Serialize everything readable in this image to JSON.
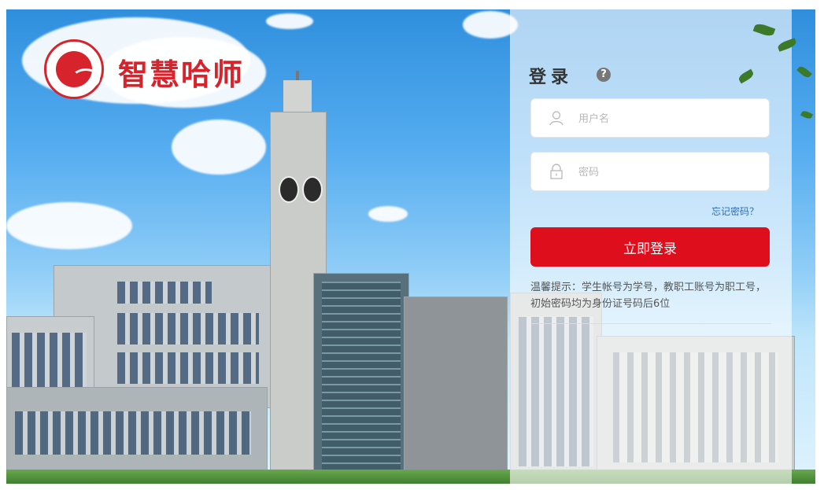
{
  "brand": {
    "name": "智慧哈师"
  },
  "login": {
    "title": "登录",
    "help_icon": "?",
    "username_placeholder": "用户名",
    "password_placeholder": "密码",
    "forgot_label": "忘记密码？",
    "submit_label": "立即登录",
    "tip": "温馨提示：学生帐号为学号，教职工账号为职工号，初始密码均为身份证号码后6位"
  },
  "colors": {
    "brand_red": "#d7232b",
    "button_red": "#df0e1c",
    "link_blue": "#2d6fb5"
  },
  "icons": {
    "user": "user-icon",
    "lock": "lock-icon",
    "help": "help-icon"
  }
}
